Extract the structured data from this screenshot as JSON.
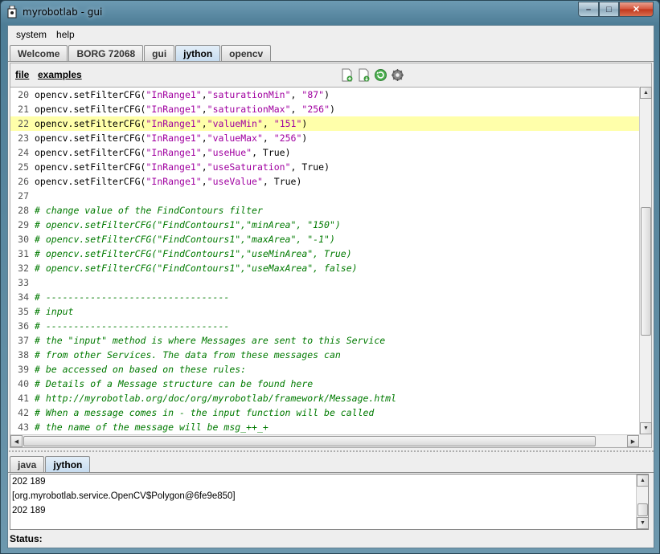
{
  "window": {
    "title": "myrobotlab - gui",
    "min_glyph": "–",
    "max_glyph": "□",
    "close_glyph": "✕"
  },
  "menubar": {
    "items": [
      "system",
      "help"
    ]
  },
  "tabs_top": [
    {
      "label": "Welcome",
      "active": false
    },
    {
      "label": "BORG 72068",
      "active": false
    },
    {
      "label": "gui",
      "active": false
    },
    {
      "label": "jython",
      "active": true
    },
    {
      "label": "opencv",
      "active": false
    }
  ],
  "editor": {
    "menu_file": "file",
    "menu_examples": "examples",
    "toolbar_icons": [
      "new-file-icon",
      "save-file-icon",
      "refresh-icon",
      "gear-icon"
    ],
    "highlighted_line": 22,
    "lines": [
      {
        "n": "20",
        "parts": [
          [
            "code",
            "opencv.setFilterCFG("
          ],
          [
            "str",
            "\"InRange1\""
          ],
          [
            "code",
            ","
          ],
          [
            "str",
            "\"saturationMin\""
          ],
          [
            "code",
            ", "
          ],
          [
            "str",
            "\"87\""
          ],
          [
            "code",
            ")"
          ]
        ]
      },
      {
        "n": "21",
        "parts": [
          [
            "code",
            "opencv.setFilterCFG("
          ],
          [
            "str",
            "\"InRange1\""
          ],
          [
            "code",
            ","
          ],
          [
            "str",
            "\"saturationMax\""
          ],
          [
            "code",
            ", "
          ],
          [
            "str",
            "\"256\""
          ],
          [
            "code",
            ")"
          ]
        ]
      },
      {
        "n": "22",
        "parts": [
          [
            "code",
            "opencv.setFilterCFG("
          ],
          [
            "str",
            "\"InRange1\""
          ],
          [
            "code",
            ","
          ],
          [
            "str",
            "\"valueMin\""
          ],
          [
            "code",
            ", "
          ],
          [
            "str",
            "\"151\""
          ],
          [
            "code",
            ")"
          ]
        ]
      },
      {
        "n": "23",
        "parts": [
          [
            "code",
            "opencv.setFilterCFG("
          ],
          [
            "str",
            "\"InRange1\""
          ],
          [
            "code",
            ","
          ],
          [
            "str",
            "\"valueMax\""
          ],
          [
            "code",
            ", "
          ],
          [
            "str",
            "\"256\""
          ],
          [
            "code",
            ")"
          ]
        ]
      },
      {
        "n": "24",
        "parts": [
          [
            "code",
            "opencv.setFilterCFG("
          ],
          [
            "str",
            "\"InRange1\""
          ],
          [
            "code",
            ","
          ],
          [
            "str",
            "\"useHue\""
          ],
          [
            "code",
            ", True)"
          ]
        ]
      },
      {
        "n": "25",
        "parts": [
          [
            "code",
            "opencv.setFilterCFG("
          ],
          [
            "str",
            "\"InRange1\""
          ],
          [
            "code",
            ","
          ],
          [
            "str",
            "\"useSaturation\""
          ],
          [
            "code",
            ", True)"
          ]
        ]
      },
      {
        "n": "26",
        "parts": [
          [
            "code",
            "opencv.setFilterCFG("
          ],
          [
            "str",
            "\"InRange1\""
          ],
          [
            "code",
            ","
          ],
          [
            "str",
            "\"useValue\""
          ],
          [
            "code",
            ", True)"
          ]
        ]
      },
      {
        "n": "27",
        "parts": []
      },
      {
        "n": "28",
        "parts": [
          [
            "cm",
            "# change value of the FindContours filter"
          ]
        ]
      },
      {
        "n": "29",
        "parts": [
          [
            "cm",
            "# opencv.setFilterCFG(\"FindContours1\",\"minArea\", \"150\")"
          ]
        ]
      },
      {
        "n": "30",
        "parts": [
          [
            "cm",
            "# opencv.setFilterCFG(\"FindContours1\",\"maxArea\", \"-1\")"
          ]
        ]
      },
      {
        "n": "31",
        "parts": [
          [
            "cm",
            "# opencv.setFilterCFG(\"FindContours1\",\"useMinArea\", True)"
          ]
        ]
      },
      {
        "n": "32",
        "parts": [
          [
            "cm",
            "# opencv.setFilterCFG(\"FindContours1\",\"useMaxArea\", false)"
          ]
        ]
      },
      {
        "n": "33",
        "parts": []
      },
      {
        "n": "34",
        "parts": [
          [
            "cm",
            "# ---------------------------------"
          ]
        ]
      },
      {
        "n": "35",
        "parts": [
          [
            "cm",
            "# input"
          ]
        ]
      },
      {
        "n": "36",
        "parts": [
          [
            "cm",
            "# ---------------------------------"
          ]
        ]
      },
      {
        "n": "37",
        "parts": [
          [
            "cm",
            "# the \"input\" method is where Messages are sent to this Service"
          ]
        ]
      },
      {
        "n": "38",
        "parts": [
          [
            "cm",
            "# from other Services. The data from these messages can"
          ]
        ]
      },
      {
        "n": "39",
        "parts": [
          [
            "cm",
            "# be accessed on based on these rules:"
          ]
        ]
      },
      {
        "n": "40",
        "parts": [
          [
            "cm",
            "# Details of a Message structure can be found here"
          ]
        ]
      },
      {
        "n": "41",
        "parts": [
          [
            "cm",
            "# http://myrobotlab.org/doc/org/myrobotlab/framework/Message.html"
          ]
        ]
      },
      {
        "n": "42",
        "parts": [
          [
            "cm",
            "# When a message comes in - the input function will be called"
          ]
        ]
      },
      {
        "n": "43",
        "parts": [
          [
            "cm",
            "# the name of the message will be msg_++_+"
          ]
        ]
      }
    ]
  },
  "tabs_bottom": [
    {
      "label": "java",
      "active": false
    },
    {
      "label": "jython",
      "active": true
    }
  ],
  "console": {
    "lines": [
      "202 189",
      "[org.myrobotlab.service.OpenCV$Polygon@6fe9e850]",
      "202 189"
    ]
  },
  "status": {
    "label": "Status:"
  },
  "colors": {
    "highlight": "#ffffaa",
    "string": "#a000a0",
    "comment": "#007a00",
    "active_tab": "#c6dcef"
  }
}
